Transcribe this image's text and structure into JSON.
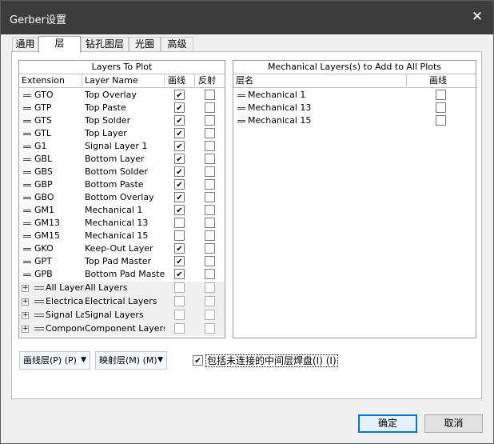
{
  "window": {
    "title": "Gerber设置",
    "close_glyph": "✕"
  },
  "tabs": [
    {
      "label": "通用",
      "active": false
    },
    {
      "label": "层",
      "active": true
    },
    {
      "label": "钻孔图层",
      "active": false
    },
    {
      "label": "光圈",
      "active": false
    },
    {
      "label": "高级",
      "active": false
    }
  ],
  "layers_to_plot": {
    "title": "Layers To Plot",
    "columns": {
      "extension": "Extension",
      "layer_name": "Layer Name",
      "plot": "画线",
      "mirror": "反射"
    },
    "rows": [
      {
        "ext": "GTO",
        "name": "Top Overlay",
        "plot": true,
        "mirror": false
      },
      {
        "ext": "GTP",
        "name": "Top Paste",
        "plot": true,
        "mirror": false
      },
      {
        "ext": "GTS",
        "name": "Top Solder",
        "plot": true,
        "mirror": false
      },
      {
        "ext": "GTL",
        "name": "Top Layer",
        "plot": true,
        "mirror": false
      },
      {
        "ext": "G1",
        "name": "Signal Layer 1",
        "plot": true,
        "mirror": false
      },
      {
        "ext": "GBL",
        "name": "Bottom Layer",
        "plot": true,
        "mirror": false
      },
      {
        "ext": "GBS",
        "name": "Bottom Solder",
        "plot": true,
        "mirror": false
      },
      {
        "ext": "GBP",
        "name": "Bottom Paste",
        "plot": true,
        "mirror": false
      },
      {
        "ext": "GBO",
        "name": "Bottom Overlay",
        "plot": true,
        "mirror": false
      },
      {
        "ext": "GM1",
        "name": "Mechanical 1",
        "plot": true,
        "mirror": false
      },
      {
        "ext": "GM13",
        "name": "Mechanical 13",
        "plot": false,
        "mirror": false
      },
      {
        "ext": "GM15",
        "name": "Mechanical 15",
        "plot": false,
        "mirror": false
      },
      {
        "ext": "GKO",
        "name": "Keep-Out Layer",
        "plot": true,
        "mirror": false
      },
      {
        "ext": "GPT",
        "name": "Top Pad Master",
        "plot": true,
        "mirror": false
      },
      {
        "ext": "GPB",
        "name": "Bottom Pad Master",
        "plot": true,
        "mirror": false
      }
    ],
    "groups": [
      {
        "expander": "+",
        "ext": "All Layers",
        "name": "All Layers"
      },
      {
        "expander": "+",
        "ext": "Electrical",
        "name": "Electrical Layers"
      },
      {
        "expander": "+",
        "ext": "Signal La",
        "name": "Signal Layers"
      },
      {
        "expander": "+",
        "ext": "Component",
        "name": "Component Layers"
      }
    ]
  },
  "mechanical": {
    "title": "Mechanical Layers(s) to Add to All Plots",
    "columns": {
      "layer_name": "层名",
      "plot": "画线"
    },
    "rows": [
      {
        "name": "Mechanical 1",
        "plot": false
      },
      {
        "name": "Mechanical 13",
        "plot": false
      },
      {
        "name": "Mechanical 15",
        "plot": false
      }
    ]
  },
  "controls": {
    "plot_layers_dropdown": "画线层(P) (P)",
    "mirror_layers_dropdown": "映射层(M) (M)",
    "include_unconnected": {
      "label": "包括未连接的中间层焊盘(I) (I)",
      "checked": true
    }
  },
  "buttons": {
    "ok": "确定",
    "cancel": "取消"
  }
}
